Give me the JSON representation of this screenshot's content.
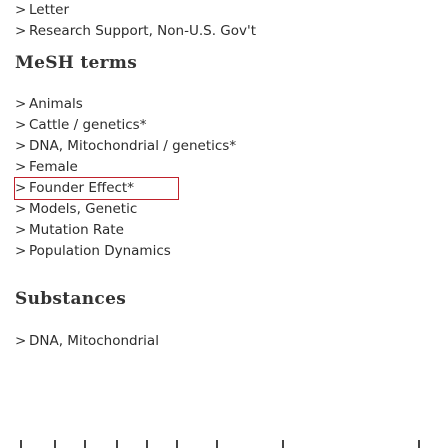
{
  "publication_types": [
    {
      "label": "Letter"
    },
    {
      "label": "Research Support, Non-U.S. Gov't"
    }
  ],
  "mesh": {
    "title": "MeSH terms",
    "terms": [
      {
        "label": "Animals"
      },
      {
        "label": "Cattle / genetics*"
      },
      {
        "label": "DNA, Mitochondrial / genetics*"
      },
      {
        "label": "Female"
      },
      {
        "label": "Founder Effect*",
        "focused": true
      },
      {
        "label": "Models, Genetic"
      },
      {
        "label": "Mutation Rate"
      },
      {
        "label": "Population Dynamics"
      }
    ]
  },
  "substances": {
    "title": "Substances",
    "items": [
      {
        "label": "DNA, Mitochondrial"
      }
    ]
  },
  "chevron_glyph": ">",
  "colors": {
    "focus_outline": "#c0202a",
    "text": "#2c2c2c"
  }
}
